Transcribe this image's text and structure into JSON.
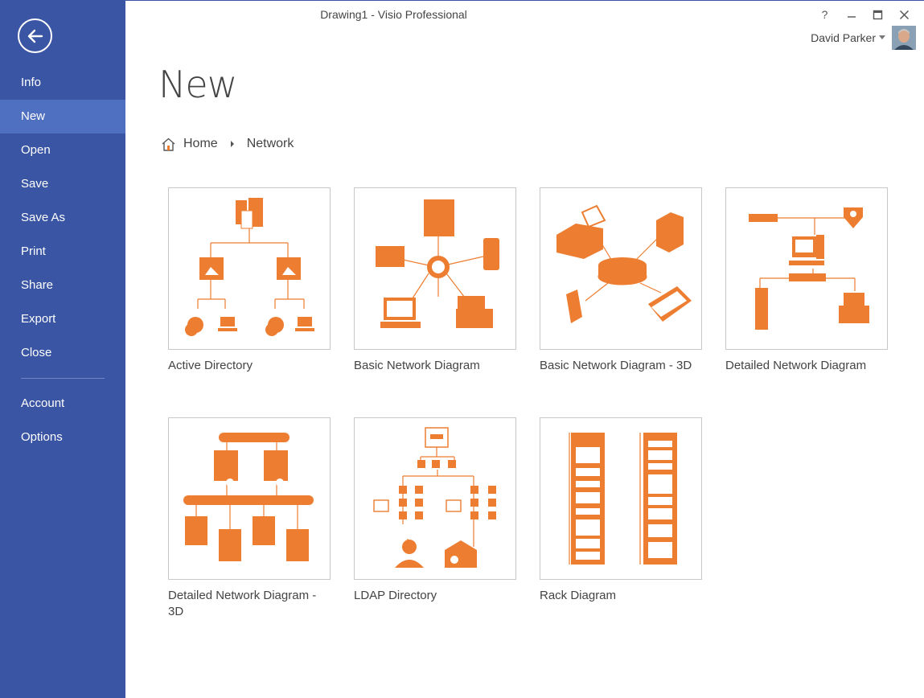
{
  "window": {
    "title": "Drawing1 - Visio Professional",
    "help": "?",
    "minimize": "–",
    "maximize": "☐",
    "close": "✕"
  },
  "user": {
    "name": "David Parker"
  },
  "sidebar": {
    "items": [
      {
        "label": "Info"
      },
      {
        "label": "New",
        "active": true
      },
      {
        "label": "Open"
      },
      {
        "label": "Save"
      },
      {
        "label": "Save As"
      },
      {
        "label": "Print"
      },
      {
        "label": "Share"
      },
      {
        "label": "Export"
      },
      {
        "label": "Close"
      },
      {
        "label": "Account"
      },
      {
        "label": "Options"
      }
    ]
  },
  "main": {
    "title": "New",
    "breadcrumb": {
      "home": "Home",
      "current": "Network"
    },
    "templates": [
      {
        "label": "Active Directory"
      },
      {
        "label": "Basic Network Diagram"
      },
      {
        "label": "Basic Network Diagram - 3D"
      },
      {
        "label": "Detailed Network Diagram"
      },
      {
        "label": "Detailed Network Diagram - 3D"
      },
      {
        "label": "LDAP Directory"
      },
      {
        "label": "Rack Diagram"
      }
    ]
  },
  "colors": {
    "sidebar": "#3955a3",
    "sidebar_active": "#4f6fc1",
    "accent_orange": "#ed7d31"
  }
}
